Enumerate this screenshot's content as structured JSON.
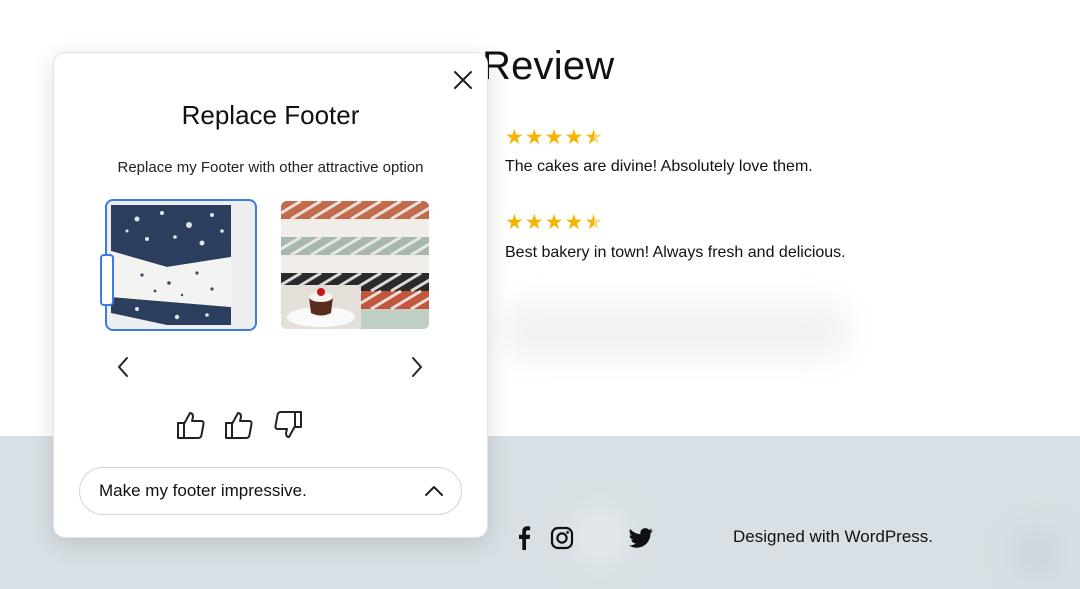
{
  "review": {
    "title": "Review",
    "items": [
      {
        "stars": "★★★★",
        "half_star": "★",
        "rating": 4.5,
        "text": "The cakes are divine! Absolutely love them."
      },
      {
        "stars": "★★★★",
        "half_star": "★",
        "rating": 4.5,
        "text": "Best bakery in town! Always fresh and delicious."
      }
    ]
  },
  "footer": {
    "social_icons": [
      "facebook-icon",
      "instagram-icon",
      "twitter-icon"
    ],
    "credit": "Designed with WordPress.",
    "background_color": "#d8e0e5"
  },
  "modal": {
    "title": "Replace Footer",
    "subtitle": "Replace my Footer with other attractive option",
    "options": [
      {
        "name": "navy-floral-pattern",
        "selected": true
      },
      {
        "name": "chevron-stripes-with-cake",
        "selected": false
      }
    ],
    "feedback_icons": [
      "thumbs-up-icon",
      "thumbs-up-icon",
      "thumbs-down-icon"
    ],
    "prompt": {
      "value": "Make my footer impressive."
    },
    "accent_color": "#3d7be0"
  }
}
